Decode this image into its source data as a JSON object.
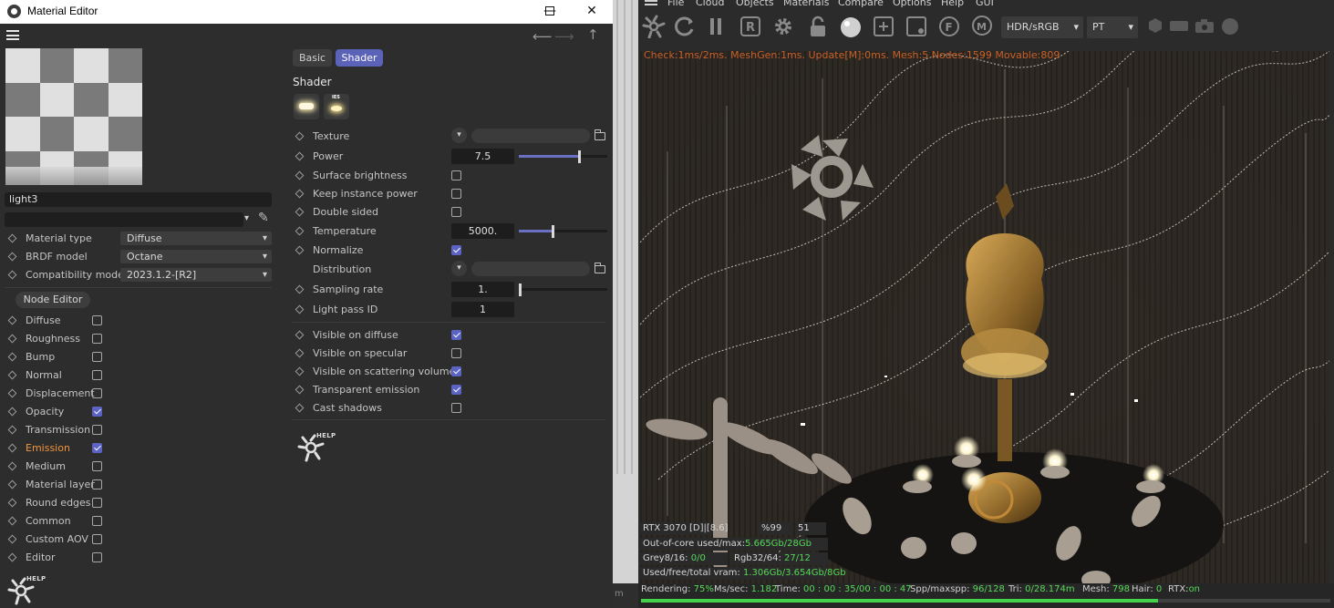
{
  "material_editor": {
    "title": "Material Editor",
    "window_buttons": {
      "minimize": "—",
      "maximize": "☐",
      "close": "✕"
    },
    "material_name": "light3",
    "material_type_label": "Material type",
    "material_type_value": "Diffuse",
    "brdf_label": "BRDF model",
    "brdf_value": "Octane",
    "compat_label": "Compatibility mode",
    "compat_value": "2023.1.2-[R2]",
    "node_editor_label": "Node Editor",
    "channels": [
      {
        "label": "Diffuse",
        "checked": false,
        "highlight": false
      },
      {
        "label": "Roughness",
        "checked": false,
        "highlight": false
      },
      {
        "label": "Bump",
        "checked": false,
        "highlight": false
      },
      {
        "label": "Normal",
        "checked": false,
        "highlight": false
      },
      {
        "label": "Displacement",
        "checked": false,
        "highlight": false
      },
      {
        "label": "Opacity",
        "checked": true,
        "highlight": false
      },
      {
        "label": "Transmission",
        "checked": false,
        "highlight": false
      },
      {
        "label": "Emission",
        "checked": true,
        "highlight": true
      },
      {
        "label": "Medium",
        "checked": false,
        "highlight": false
      },
      {
        "label": "Material layer",
        "checked": false,
        "highlight": false
      },
      {
        "label": "Round edges",
        "checked": false,
        "highlight": false
      },
      {
        "label": "Common",
        "checked": false,
        "highlight": false
      },
      {
        "label": "Custom AOV",
        "checked": false,
        "highlight": false
      },
      {
        "label": "Editor",
        "checked": false,
        "highlight": false
      }
    ],
    "help_text": "HELP",
    "tabs": {
      "basic": "Basic",
      "shader": "Shader"
    },
    "shader_section_title": "Shader",
    "shader_icon_ies_label": "IES",
    "props": {
      "texture": "Texture",
      "power": "Power",
      "power_value": "7.5",
      "power_fraction": 0.68,
      "surface_brightness": "Surface brightness",
      "keep_instance_power": "Keep instance power",
      "double_sided": "Double sided",
      "temperature": "Temperature",
      "temperature_value": "5000.",
      "temperature_fraction": 0.38,
      "normalize": "Normalize",
      "distribution": "Distribution",
      "sampling_rate": "Sampling rate",
      "sampling_rate_value": "1.",
      "sampling_fraction": 0.0,
      "light_pass_id": "Light pass ID",
      "light_pass_id_value": "1",
      "visible_on_diffuse": "Visible on diffuse",
      "visible_on_specular": "Visible on specular",
      "visible_on_scattering": "Visible on scattering volumes",
      "transparent_emission": "Transparent emission",
      "cast_shadows": "Cast shadows"
    },
    "checks": {
      "surface_brightness": false,
      "keep_instance_power": false,
      "double_sided": false,
      "normalize": true,
      "visible_on_diffuse": true,
      "visible_on_specular": false,
      "visible_on_scattering": true,
      "transparent_emission": true,
      "cast_shadows": false
    }
  },
  "gap_text": "m",
  "render_viewer": {
    "menu": [
      "File",
      "Cloud",
      "Objects",
      "Materials",
      "Compare",
      "Options",
      "Help",
      "GUI"
    ],
    "colorspace": "HDR/sRGB",
    "kernel": "PT",
    "status_line": "Check:1ms/2ms. MeshGen:1ms. Update[M]:0ms. Mesh:5 Nodes:1599 Movable:809",
    "gpu": "RTX 3070 [D]|[8.6]",
    "gpu_pct": "%99",
    "gpu_temp": "51",
    "ooc_label": "Out-of-core used/max:",
    "ooc_value": "5.665Gb/28Gb",
    "grey_label": "Grey8/16:",
    "grey_value": "0/0",
    "rgb_label": "Rgb32/64:",
    "rgb_value": "27/12",
    "vram_label": "Used/free/total vram:",
    "vram_value": "1.306Gb/3.654Gb/8Gb",
    "rendering_label": "Rendering:",
    "rendering_value": "75%",
    "rendering_fraction": 0.75,
    "mssec_label": "Ms/sec:",
    "mssec_value": "1.182",
    "time_label": "Time:",
    "time_value": "00 : 00 : 35/00 : 00 : 47",
    "spp_label": "Spp/maxspp:",
    "spp_value": "96/128",
    "tri_label": "Tri:",
    "tri_value": "0/28.174m",
    "mesh_label": "Mesh:",
    "mesh_value": "798",
    "hair_label": "Hair:",
    "hair_value": "0",
    "rtx_label": "RTX:",
    "rtx_value": "on"
  },
  "colors": {
    "accent": "#5b63c4",
    "orange": "#f0963c",
    "green": "#44d24a",
    "status_orange": "#c8602a"
  }
}
